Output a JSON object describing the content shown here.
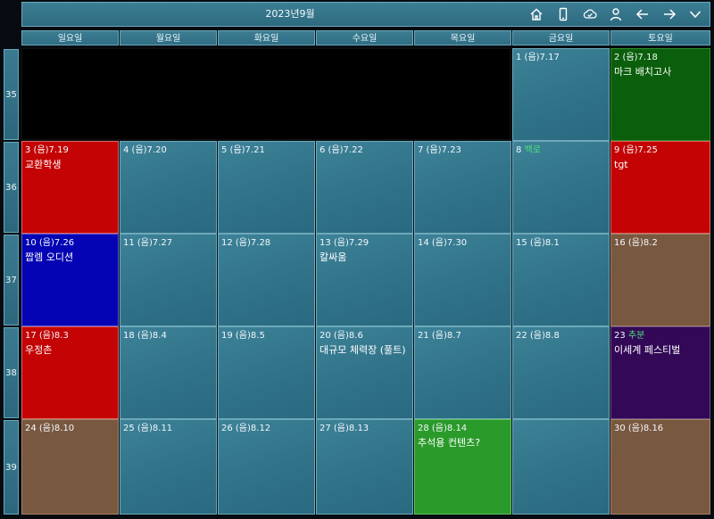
{
  "header": {
    "title": "2023년9월"
  },
  "toolbar": {
    "icons": [
      "home-icon",
      "phone-icon",
      "cloud-check-icon",
      "person-icon",
      "arrow-left-icon",
      "arrow-right-icon",
      "chevron-down-icon"
    ]
  },
  "weekdays": [
    "일요일",
    "월요일",
    "화요일",
    "수요일",
    "목요일",
    "금요일",
    "토요일"
  ],
  "weeks": [
    "35",
    "36",
    "37",
    "38",
    "39"
  ],
  "days": {
    "d1": {
      "date": "1 (음)7.17",
      "event": ""
    },
    "d2": {
      "date": "2 (음)7.18",
      "event": "마크 배치고사"
    },
    "d3": {
      "date": "3 (음)7.19",
      "event": "교환학생"
    },
    "d4": {
      "date": "4 (음)7.20",
      "event": ""
    },
    "d5": {
      "date": "5 (음)7.21",
      "event": ""
    },
    "d6": {
      "date": "6 (음)7.22",
      "event": ""
    },
    "d7": {
      "date": "7 (음)7.23",
      "event": ""
    },
    "d8": {
      "date": "8",
      "holiday": "백로",
      "event": ""
    },
    "d9": {
      "date": "9 (음)7.25",
      "event": "tgt"
    },
    "d10": {
      "date": "10 (음)7.26",
      "event": "짭렘 오디션"
    },
    "d11": {
      "date": "11 (음)7.27",
      "event": ""
    },
    "d12": {
      "date": "12 (음)7.28",
      "event": ""
    },
    "d13": {
      "date": "13 (음)7.29",
      "event": "칼싸움"
    },
    "d14": {
      "date": "14 (음)7.30",
      "event": ""
    },
    "d15": {
      "date": "15 (음)8.1",
      "event": ""
    },
    "d16": {
      "date": "16 (음)8.2",
      "event": ""
    },
    "d17": {
      "date": "17 (음)8.3",
      "event": "우정촌"
    },
    "d18": {
      "date": "18 (음)8.4",
      "event": ""
    },
    "d19": {
      "date": "19 (음)8.5",
      "event": ""
    },
    "d20": {
      "date": "20 (음)8.6",
      "event": "대규모 체력장 (풀트)"
    },
    "d21": {
      "date": "21 (음)8.7",
      "event": ""
    },
    "d22": {
      "date": "22 (음)8.8",
      "event": ""
    },
    "d23": {
      "date": "23",
      "holiday": "추분",
      "event": "이세계 페스티벌"
    },
    "d24": {
      "date": "24 (음)8.10",
      "event": ""
    },
    "d25": {
      "date": "25 (음)8.11",
      "event": ""
    },
    "d26": {
      "date": "26 (음)8.12",
      "event": ""
    },
    "d27": {
      "date": "27 (음)8.13",
      "event": ""
    },
    "d28": {
      "date": "28 (음)8.14",
      "event": "추석용 컨텐츠?"
    },
    "d29": {
      "date": "",
      "event": ""
    },
    "d30": {
      "date": "30 (음)8.16",
      "event": ""
    }
  },
  "colors": {
    "red": "#c40404",
    "dark_green": "#0b5e0b",
    "blue": "#0404b4",
    "brown": "#795840",
    "purple": "#330857",
    "lime": "#2a9a2a",
    "holiday_text": "#4ee07b"
  }
}
